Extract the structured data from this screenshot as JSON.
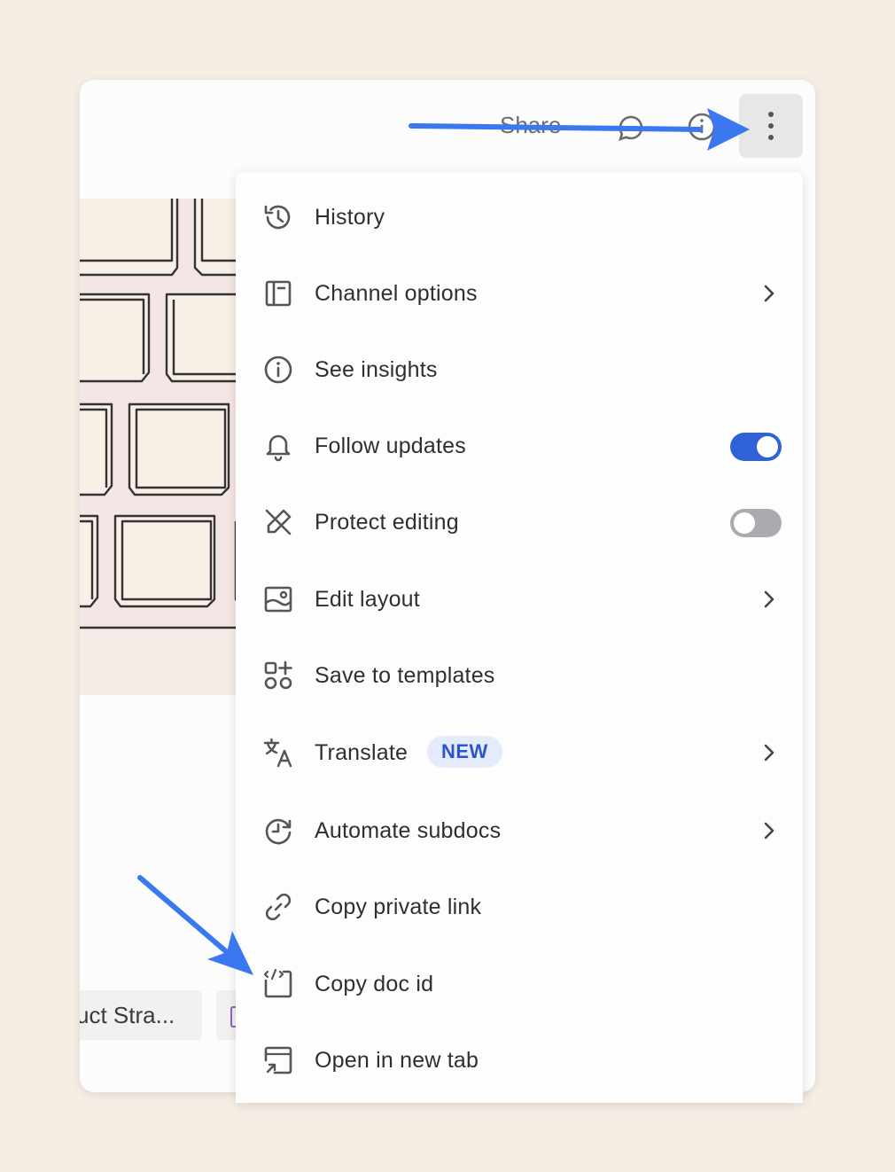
{
  "topbar": {
    "share_label": "Share"
  },
  "chips": [
    {
      "label": "uct Stra..."
    }
  ],
  "menu": {
    "items": [
      {
        "label": "History",
        "icon": "history-icon"
      },
      {
        "label": "Channel options",
        "icon": "layout-sidebar-icon"
      },
      {
        "label": "See insights",
        "icon": "info-circle-icon"
      },
      {
        "label": "Follow updates",
        "icon": "bell-icon",
        "toggle_on": true
      },
      {
        "label": "Protect editing",
        "icon": "pencil-off-icon",
        "toggle_on": false
      },
      {
        "label": "Edit layout",
        "icon": "image-layout-icon"
      },
      {
        "label": "Save to templates",
        "icon": "shapes-plus-icon"
      },
      {
        "label": "Translate",
        "icon": "translate-icon",
        "badge": "NEW"
      },
      {
        "label": "Automate subdocs",
        "icon": "clock-refresh-icon"
      },
      {
        "label": "Copy private link",
        "icon": "link-icon"
      },
      {
        "label": "Copy doc id",
        "icon": "code-doc-icon"
      },
      {
        "label": "Open in new tab",
        "icon": "open-new-tab-icon"
      }
    ]
  },
  "colors": {
    "page_bg": "#f6eee5",
    "accent_blue": "#2f62d6",
    "toggle_off": "#a9abae",
    "badge_bg": "#e4ecfb",
    "badge_text": "#2b55c8",
    "annotation_arrow": "#3b78f0"
  }
}
